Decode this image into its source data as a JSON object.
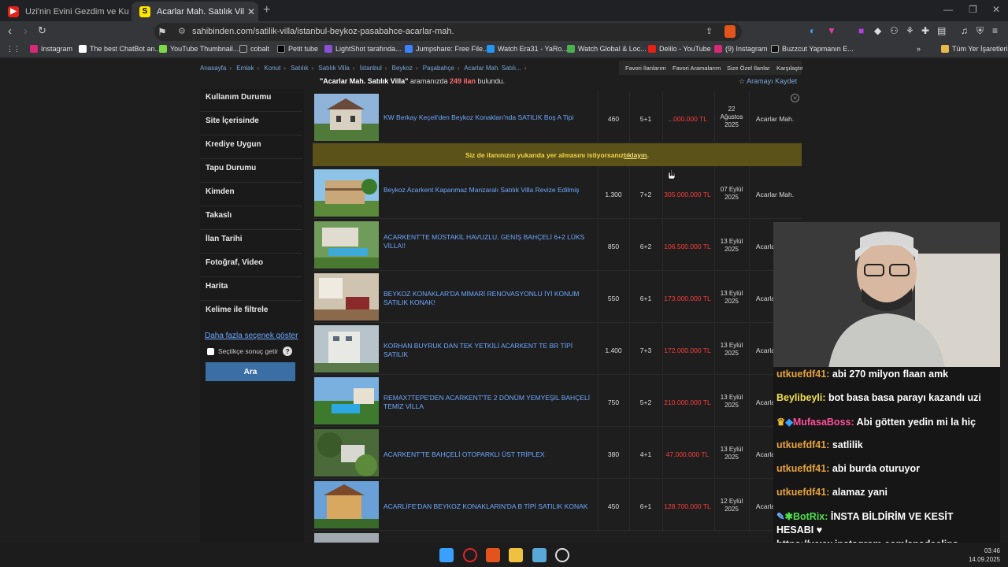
{
  "browser": {
    "tabs": [
      {
        "title": "Uzi'nin Evini Gezdim ve Kurbağa Tera",
        "active": false
      },
      {
        "title": "Acarlar Mah. Satılık Villa Fiyatları",
        "active": true
      }
    ],
    "url": "sahibinden.com/satilik-villa/istanbul-beykoz-pasabahce-acarlar-mah.",
    "bookmarks": [
      "Instagram",
      "The best ChatBot an...",
      "YouTube Thumbnail...",
      "cobalt",
      "Petit tube",
      "LightShot tarafında...",
      "Jumpshare: Free File...",
      "Watch Era31 - YaRo...",
      "Watch Global & Loc...",
      "Delilo - YouTube",
      "(9) Instagram",
      "Buzzcut Yapmanın E..."
    ],
    "all_bookmarks": "Tüm Yer İşaretleri"
  },
  "breadcrumb": [
    "Anasayfa",
    "Emlak",
    "Konut",
    "Satılık",
    "Satılık Villa",
    "İstanbul",
    "Beykoz",
    "Paşabahçe",
    "Acarlar Mah. Satılı..."
  ],
  "top_links": [
    "Favori İlanlarım",
    "Favori Aramalarım",
    "Size Özel İlanlar",
    "Karşılaştır"
  ],
  "result": {
    "query": "\"Acarlar Mah. Satılık Villa\"",
    "prefix": " aramanızda ",
    "count": "249 ilan",
    "suffix": " bulundu."
  },
  "save_search": "Aramayı Kaydet",
  "sidebar": {
    "items": [
      "Kullanım Durumu",
      "Site İçerisinde",
      "Krediye Uygun",
      "Tapu Durumu",
      "Kimden",
      "Takaslı",
      "İlan Tarihi",
      "Fotoğraf, Video",
      "Harita",
      "Kelime ile filtrele"
    ],
    "more_link": "Daha fazla seçenek göster",
    "checkbox_label": "Seçtikçe sonuç getir",
    "help": "?",
    "search_button": "Ara"
  },
  "promo": {
    "text": "Siz de ilanınızın yukarıda yer almasını istiyorsanız ",
    "link": "tıklayın",
    "end": "."
  },
  "listings": [
    {
      "title": "KW Berkay Keçeli'den Beykoz Konakları'nda SATILIK Boş A Tipi",
      "m2": "460",
      "rooms": "5+1",
      "price": "...000.000 TL",
      "date": [
        "22",
        "Ağustos",
        "2025"
      ],
      "loc": "Acarlar Mah."
    },
    {
      "title": "Beykoz Acarkent Kapanmaz Manzaralı Satılık Villa Revize Edilmiş",
      "m2": "1.300",
      "rooms": "7+2",
      "price": "305.000.000 TL",
      "date": [
        "07 Eylül",
        "2025"
      ],
      "loc": "Acarlar Mah."
    },
    {
      "title": "ACARKENT'TE MÜSTAKİL HAVUZLU, GENİŞ BAHÇELİ 6+2 LÜKS VİLLA!!",
      "m2": "850",
      "rooms": "6+2",
      "price": "106.500.000 TL",
      "date": [
        "13 Eylül",
        "2025"
      ],
      "loc": "Acarlar Mah."
    },
    {
      "title": "BEYKOZ KONAKLAR'DA MİMARİ RENOVASYONLU İYİ KONUM SATILIK KONAK!",
      "m2": "550",
      "rooms": "6+1",
      "price": "173.000.000 TL",
      "date": [
        "13 Eylül",
        "2025"
      ],
      "loc": "Acarlar Mah."
    },
    {
      "title": "KORHAN BUYRUK DAN TEK YETKİLİ ACARKENT TE BR TİPİ SATILIK",
      "m2": "1.400",
      "rooms": "7+3",
      "price": "172.000.000 TL",
      "date": [
        "13 Eylül",
        "2025"
      ],
      "loc": "Acarlar Mah."
    },
    {
      "title": "REMAX7TEPE'DEN ACARKENT'TE 2 DÖNÜM YEMYEŞİL BAHÇELİ TEMİZ VİLLA",
      "m2": "750",
      "rooms": "5+2",
      "price": "210.000.000 TL",
      "date": [
        "13 Eylül",
        "2025"
      ],
      "loc": "Acarlar Mah."
    },
    {
      "title": "ACARKENT'TE BAHÇELİ OTOPARKLI ÜST TRİPLEX",
      "m2": "380",
      "rooms": "4+1",
      "price": "47.000.000 TL",
      "date": [
        "13 Eylül",
        "2025"
      ],
      "loc": "Acarlar Mah."
    },
    {
      "title": "ACARLİFE'DAN BEYKOZ KONAKLARIN'DA B TİPİ SATILIK KONAK",
      "m2": "450",
      "rooms": "6+1",
      "price": "128.700.000 TL",
      "date": [
        "12 Eylül",
        "2025"
      ],
      "loc": "Acarlar Mah."
    }
  ],
  "chat": [
    {
      "user": "utkuefdf41:",
      "msg": " abi 270 milyon flaan amk",
      "color": "#e8a33d"
    },
    {
      "user": "Beylibeyli:",
      "msg": " bot basa basa parayı kazandı uzi",
      "color": "#f4e04d"
    },
    {
      "user": "MufasaBoss:",
      "msg": " Abi götten yedin mi la hiç",
      "color": "#ff4f9a"
    },
    {
      "user": "utkuefdf41:",
      "msg": " satlilik",
      "color": "#e8a33d"
    },
    {
      "user": "utkuefdf41:",
      "msg": " abi burda oturuyor",
      "color": "#e8a33d"
    },
    {
      "user": "utkuefdf41:",
      "msg": " alamaz yani",
      "color": "#e8a33d"
    },
    {
      "user": "BotRix:",
      "msg": " İNSTA BİLDİRİM VE KESİT",
      "color": "#4ee04e"
    },
    {
      "user": "",
      "msg": "HESABI ♥",
      "color": "#fff"
    },
    {
      "user": "",
      "msg": "https://www.instagram.com/spadeclips",
      "color": "#fff"
    }
  ],
  "clock": {
    "time": "03:46",
    "date": "14.09.2025"
  }
}
